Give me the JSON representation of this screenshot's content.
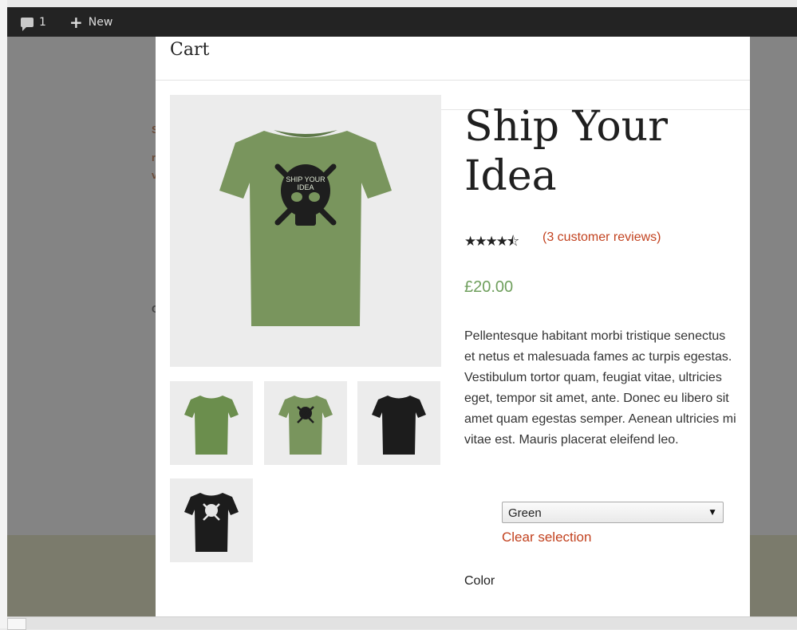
{
  "admin_bar": {
    "comments_count": "1",
    "new_label": "New"
  },
  "modal": {
    "header_title": "Cart"
  },
  "product": {
    "title": "Ship Your Idea",
    "rating": {
      "value": 4.5,
      "max": 5,
      "stars": "★★★★⯪"
    },
    "reviews_link": "(3 customer reviews)",
    "price": "£20.00",
    "description": "Pellentesque habitant morbi tristique senectus et netus et malesuada fames ac turpis egestas. Vestibulum tortor quam, feugiat vitae, ultricies eget, tempor sit amet, ante. Donec eu libero sit amet quam egestas semper. Aenean ultricies mi vitae est. Mauris placerat eleifend leo.",
    "variation": {
      "selected": "Green",
      "clear_label": "Clear selection",
      "attribute_label": "Color"
    },
    "gallery": {
      "main": {
        "shirt_color": "#79955d",
        "print": "Ship Your Idea skull"
      },
      "thumbs": [
        {
          "shirt_color": "#6b8e4d",
          "print": "back-plain"
        },
        {
          "shirt_color": "#79955d",
          "print": "skull"
        },
        {
          "shirt_color": "#1c1c1c",
          "print": "back-plain"
        },
        {
          "shirt_color": "#1c1c1c",
          "print": "skull"
        }
      ]
    }
  },
  "colors": {
    "accent": "#c2421f",
    "price": "#6f9f5d",
    "admin_bar": "#232323",
    "overlay": "#848484"
  }
}
